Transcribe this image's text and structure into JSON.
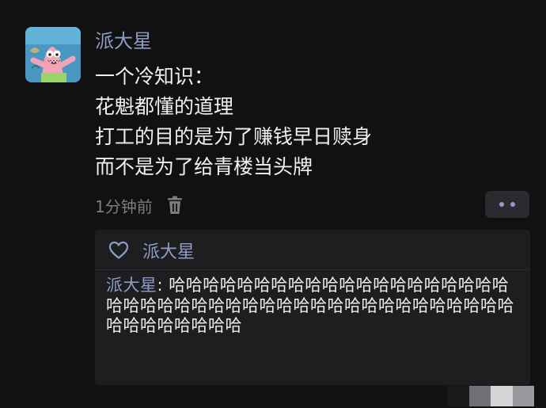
{
  "post": {
    "author": "派大星",
    "content_lines": [
      "一个冷知识：",
      "花魁都懂的道理",
      "打工的目的是为了赚钱早日赎身",
      "而不是为了给青楼当头牌"
    ],
    "timestamp": "1分钟前",
    "icons": {
      "delete": "trash-icon",
      "more": "more-dots-icon",
      "like": "heart-icon"
    }
  },
  "reply_box": {
    "liker": "派大星",
    "comment": {
      "author": "派大星",
      "separator": ": ",
      "text": "哈哈哈哈哈哈哈哈哈哈哈哈哈哈哈哈哈哈哈哈哈哈哈哈哈哈哈哈哈哈哈哈哈哈哈哈哈哈哈哈哈哈哈哈哈哈哈哈哈哈哈哈"
    }
  },
  "colors": {
    "background": "#111112",
    "name_accent": "#8e9cc9",
    "text": "#ededed",
    "muted": "#7b7b80",
    "panel": "#1e1e20"
  }
}
